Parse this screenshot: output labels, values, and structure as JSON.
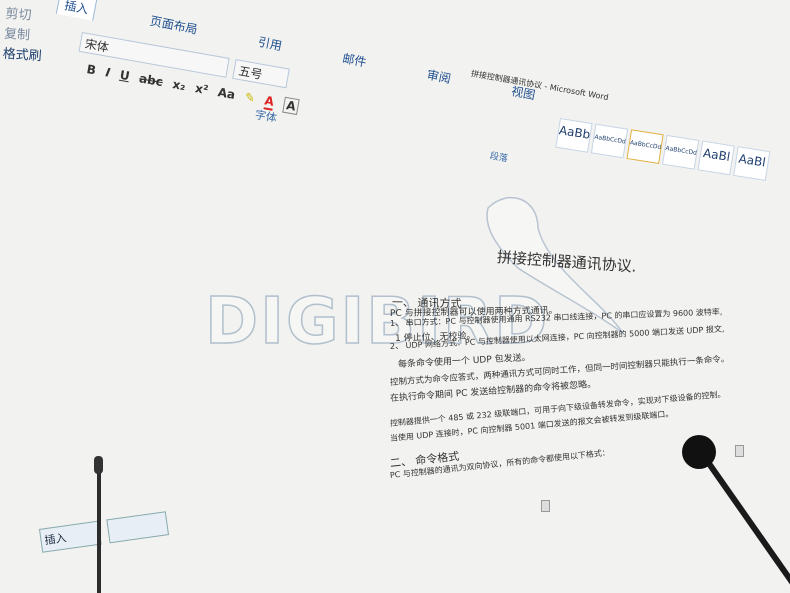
{
  "ribbon": {
    "tabs": [
      "插入",
      "页面布局",
      "引用",
      "邮件",
      "审阅",
      "视图"
    ],
    "clipboard": {
      "cut": "剪切",
      "copy": "复制",
      "format_painter": "格式刷"
    },
    "font_name": "宋体",
    "font_size": "五号",
    "buttons": [
      "B",
      "I",
      "U",
      "abc",
      "x₂",
      "x²",
      "Aa",
      "A",
      "A"
    ],
    "font_group_label": "字体",
    "paragraph_group_label": "段落",
    "styles": [
      "AaBb",
      "AaBbCcDd",
      "AaBbCcDd",
      "AaBbCcDd",
      "AaBl",
      "AaBl"
    ]
  },
  "window_title": "拼接控制器通讯协议 - Microsoft Word",
  "document": {
    "title": "拼接控制器通讯协议.",
    "lines": [
      "一、    通讯方式",
      "PC 与拼接控制器可以使用两种方式通讯。",
      "1、 串口方式：PC 与控制器使用通用 RS232 串口线连接，PC 的串口应设置为 9600 波特率,",
      "    1 停止位、无校验。",
      "2、 UDP 网络方式：PC 与控制器使用以太网连接，PC 向控制器的 5000 端口发送 UDP 报文,",
      "    每条命令使用一个 UDP 包发送。",
      "控制方式为命令应答式，两种通讯方式可同时工作，但同一时间控制器只能执行一条命令。",
      "在执行命令期间 PC 发送给控制器的命令将被忽略。",
      "控制器提供一个 485 或 232 级联端口，可用于向下级设备转发命令，实现对下级设备的控制。",
      "当使用 UDP 连接时，PC 向控制器 5001 端口发送的报文会被转发到级联端口。",
      "二、    命令格式",
      "PC 与控制器的通讯为双向协议，所有的命令都使用以下格式："
    ]
  },
  "watermark": "DIGIBIRD",
  "taskbar": {
    "items": [
      "插入"
    ]
  }
}
